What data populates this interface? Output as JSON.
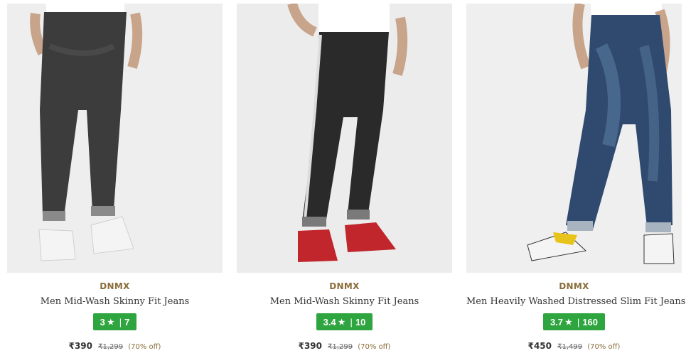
{
  "products": [
    {
      "brand": "DNMX",
      "title": "Men Mid-Wash Skinny Fit Jeans",
      "rating": "3",
      "star": "★",
      "separator": "|",
      "reviews": "7",
      "price": "₹390",
      "mrp": "₹1,299",
      "discount": "(70% off)"
    },
    {
      "brand": "DNMX",
      "title": "Men Mid-Wash Skinny Fit Jeans",
      "rating": "3.4",
      "star": "★",
      "separator": "|",
      "reviews": "10",
      "price": "₹390",
      "mrp": "₹1,299",
      "discount": "(70% off)"
    },
    {
      "brand": "DNMX",
      "title": "Men Heavily Washed Distressed Slim Fit Jeans",
      "rating": "3.7",
      "star": "★",
      "separator": "|",
      "reviews": "160",
      "price": "₹450",
      "mrp": "₹1,499",
      "discount": "(70% off)"
    }
  ],
  "colors": {
    "brand": "#8b6e3b",
    "rating_badge": "#2ea53e",
    "jeans_1": "#3c3c3c",
    "jeans_2": "#2a2a2a",
    "jeans_3": "#2f4a6e"
  }
}
